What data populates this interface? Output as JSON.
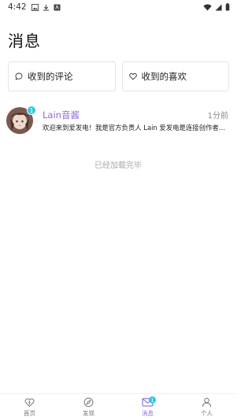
{
  "status_bar": {
    "time": "4:42",
    "icons": [
      "image-icon",
      "download-icon",
      "app-icon"
    ],
    "right_icons": [
      "wifi-icon",
      "signal-icon",
      "battery-icon"
    ]
  },
  "page": {
    "title": "消息"
  },
  "actions": {
    "comments_label": "收到的评论",
    "likes_label": "收到的喜欢"
  },
  "messages": [
    {
      "sender": "Lain音酱",
      "time": "1分前",
      "preview": "欢迎来到爱发电！我是官方负责人 Lain 爱发电是连接创作者与粉...",
      "unread": "1"
    }
  ],
  "list_footer": "已经加载完毕",
  "bottom_nav": {
    "items": [
      {
        "label": "首页",
        "icon": "home-icon"
      },
      {
        "label": "发现",
        "icon": "discover-icon"
      },
      {
        "label": "消息",
        "icon": "message-icon",
        "badge": "1",
        "active": true
      },
      {
        "label": "个人",
        "icon": "person-icon"
      }
    ]
  },
  "colors": {
    "accent": "#8a6bd8",
    "badge": "#2fc7e6",
    "muted": "#aaaaaa"
  }
}
